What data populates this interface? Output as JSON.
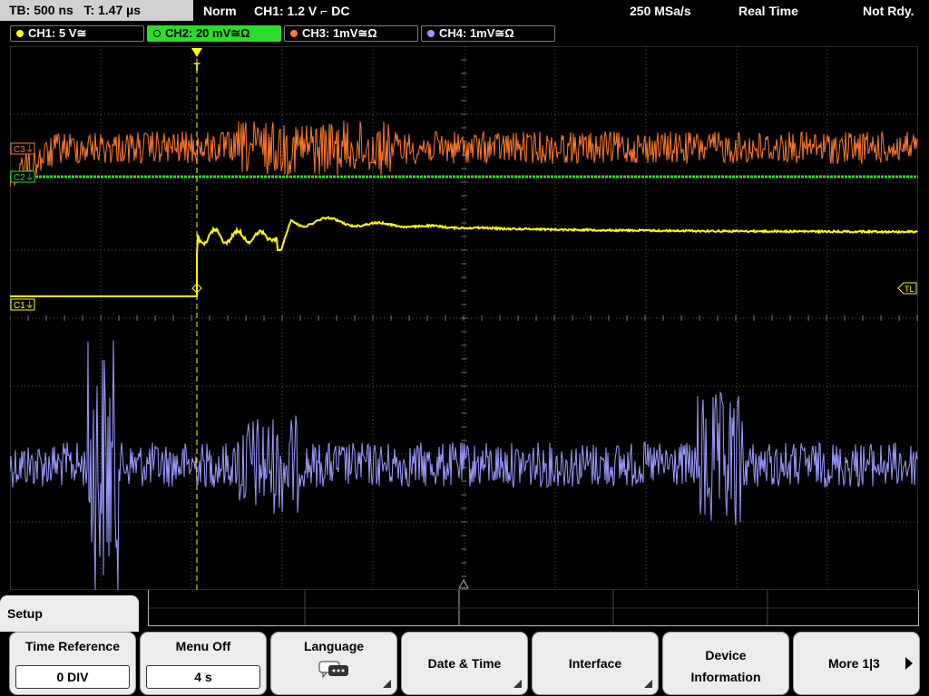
{
  "status_bar": {
    "timebase": "TB: 500 ns",
    "trigger_time": "T: 1.47 µs",
    "trigger_mode": "Norm",
    "trigger_setup": "CH1: 1.2 V ⌐ DC",
    "sample_rate": "250 MSa/s",
    "acq_mode": "Real Time",
    "state": "Not Rdy."
  },
  "channels": [
    {
      "label": "CH1: 5 V≅",
      "color": "#ffff00"
    },
    {
      "label": "CH2: 20 mV≅Ω",
      "color": "#2bdc2b"
    },
    {
      "label": "CH3: 1mV≅Ω",
      "color": "#ff7a2a"
    },
    {
      "label": "CH4: 1mV≅Ω",
      "color": "#9b9bff"
    }
  ],
  "scope": {
    "grid_color": "#555555",
    "markers": {
      "c3": "C3⏚",
      "c2": "C2⏚",
      "c1": "C1⏚",
      "trigger_level": "TL",
      "trigger_marker": "T"
    }
  },
  "menu": {
    "title": "Setup",
    "softkeys": [
      {
        "label": "Time Reference",
        "value": "0 DIV"
      },
      {
        "label": "Menu Off",
        "value": "4 s"
      },
      {
        "label": "Language",
        "icon": "speech-bubbles-icon"
      },
      {
        "label": "Date & Time"
      },
      {
        "label": "Interface"
      },
      {
        "label": "Device Information"
      },
      {
        "label": "More 1|3"
      }
    ]
  }
}
